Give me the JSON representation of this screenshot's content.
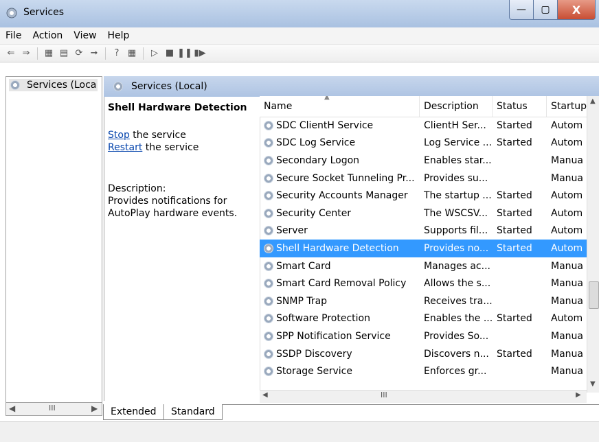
{
  "window": {
    "title": "Services"
  },
  "menu": [
    "File",
    "Action",
    "View",
    "Help"
  ],
  "tree": {
    "item_label": "Services (Loca"
  },
  "main": {
    "header_label": "Services (Local)",
    "details": {
      "service_name": "Shell Hardware Detection",
      "stop_link": "Stop",
      "stop_suffix": " the service",
      "restart_link": "Restart",
      "restart_suffix": " the service",
      "description_label": "Description:",
      "description_text": "Provides notifications for AutoPlay hardware events."
    },
    "columns": [
      "Name",
      "Description",
      "Status",
      "Startup"
    ],
    "rows": [
      {
        "name": "SDC ClientH Service",
        "description": "ClientH Ser...",
        "status": "Started",
        "startup": "Autom"
      },
      {
        "name": "SDC Log Service",
        "description": "Log Service ...",
        "status": "Started",
        "startup": "Autom"
      },
      {
        "name": "Secondary Logon",
        "description": "Enables star...",
        "status": "",
        "startup": "Manua"
      },
      {
        "name": "Secure Socket Tunneling Pr...",
        "description": "Provides su...",
        "status": "",
        "startup": "Manua"
      },
      {
        "name": "Security Accounts Manager",
        "description": "The startup ...",
        "status": "Started",
        "startup": "Autom"
      },
      {
        "name": "Security Center",
        "description": "The WSCSV...",
        "status": "Started",
        "startup": "Autom"
      },
      {
        "name": "Server",
        "description": "Supports fil...",
        "status": "Started",
        "startup": "Autom"
      },
      {
        "name": "Shell Hardware Detection",
        "description": "Provides no...",
        "status": "Started",
        "startup": "Autom",
        "selected": true
      },
      {
        "name": "Smart Card",
        "description": "Manages ac...",
        "status": "",
        "startup": "Manua"
      },
      {
        "name": "Smart Card Removal Policy",
        "description": "Allows the s...",
        "status": "",
        "startup": "Manua"
      },
      {
        "name": "SNMP Trap",
        "description": "Receives tra...",
        "status": "",
        "startup": "Manua"
      },
      {
        "name": "Software Protection",
        "description": "Enables the ...",
        "status": "Started",
        "startup": "Autom"
      },
      {
        "name": "SPP Notification Service",
        "description": "Provides So...",
        "status": "",
        "startup": "Manua"
      },
      {
        "name": "SSDP Discovery",
        "description": "Discovers n...",
        "status": "Started",
        "startup": "Manua"
      },
      {
        "name": "Storage Service",
        "description": "Enforces gr...",
        "status": "",
        "startup": "Manua"
      }
    ]
  },
  "tabs": [
    "Extended",
    "Standard"
  ],
  "scrollbar": {
    "grip": "III"
  },
  "colors": {
    "selection": "#3399ff",
    "header_gradient": "#aec4e3",
    "link": "#0645ad"
  }
}
